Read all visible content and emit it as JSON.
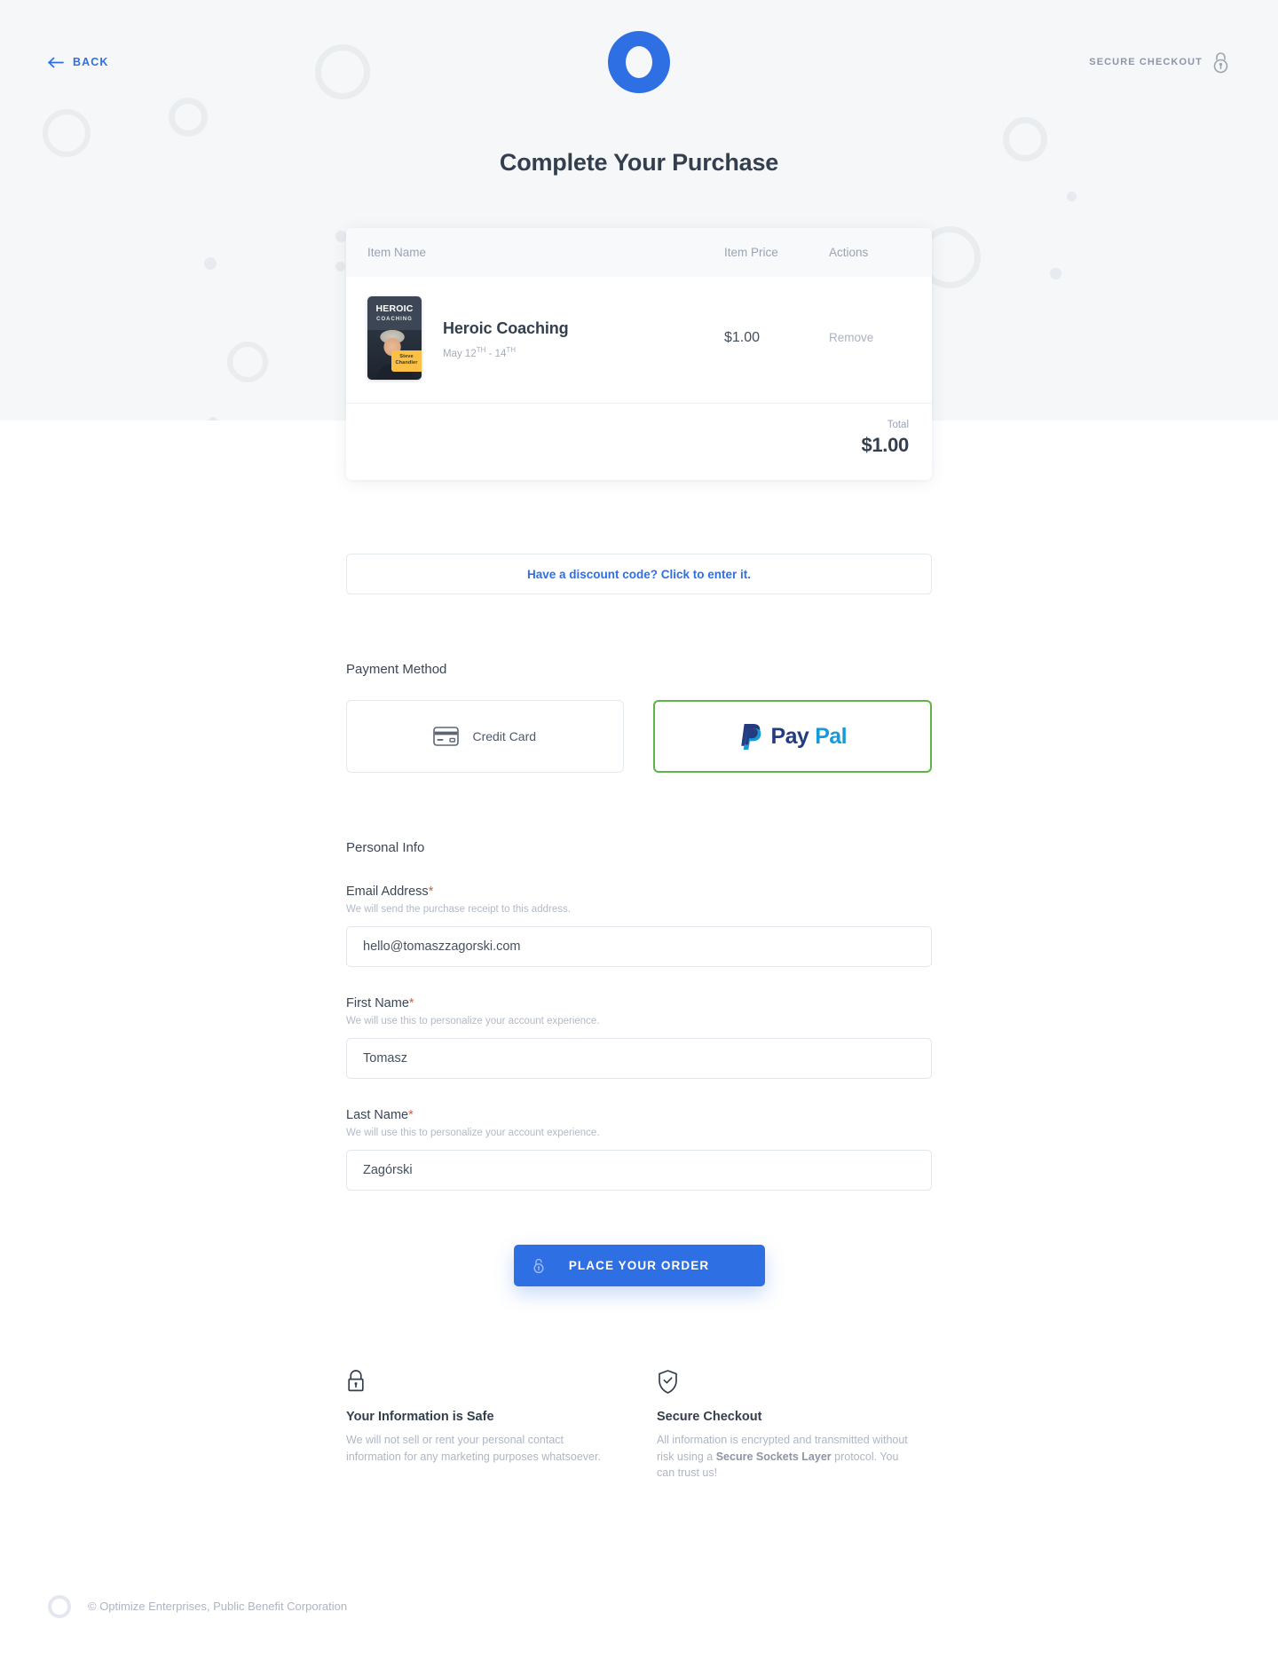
{
  "header": {
    "back_label": "BACK",
    "back_icon": "arrow-left-icon",
    "logo_icon": "optimize-ring-logo",
    "secure_label": "SECURE CHECKOUT",
    "secure_icon": "padlock-round-icon"
  },
  "page_title": "Complete Your Purchase",
  "cart": {
    "columns": {
      "item_name": "Item Name",
      "item_price": "Item Price",
      "actions": "Actions"
    },
    "items": [
      {
        "thumb_title": "HEROIC",
        "thumb_subtitle": "COACHING",
        "thumb_tag_line1": "Steve",
        "thumb_tag_line2": "Chandler",
        "name": "Heroic Coaching",
        "date_prefix": "May 12",
        "date_sup1": "TH",
        "date_middle": " - 14",
        "date_sup2": "TH",
        "price": "$1.00",
        "remove_label": "Remove"
      }
    ],
    "total_label": "Total",
    "total_value": "$1.00"
  },
  "discount": {
    "label": "Have a discount code? Click to enter it."
  },
  "payment": {
    "section_title": "Payment Method",
    "options": [
      {
        "label": "Credit Card",
        "icon": "credit-card-icon",
        "selected": false
      },
      {
        "label_part1": "Pay",
        "label_part2": "Pal",
        "icon": "paypal-logo-icon",
        "selected": true
      }
    ]
  },
  "personal_info": {
    "section_title": "Personal Info",
    "fields": [
      {
        "label": "Email Address",
        "required_mark": "*",
        "help": "We will send the purchase receipt to this address.",
        "value": "hello@tomaszzagorski.com"
      },
      {
        "label": "First Name",
        "required_mark": "*",
        "help": "We will use this to personalize your account experience.",
        "value": "Tomasz"
      },
      {
        "label": "Last Name",
        "required_mark": "*",
        "help": "We will use this to personalize your account experience.",
        "value": "Zagórski"
      }
    ]
  },
  "order_button": {
    "label": "PLACE YOUR ORDER",
    "icon": "padlock-open-icon"
  },
  "trust": [
    {
      "icon": "padlock-icon",
      "title": "Your Information is Safe",
      "text": "We will not sell or rent your personal contact information for any marketing purposes whatsoever."
    },
    {
      "icon": "shield-check-icon",
      "title": "Secure Checkout",
      "text_part1": "All information is encrypted and transmitted without risk using a ",
      "text_bold": "Secure Sockets Layer",
      "text_part2": " protocol. You can trust us!"
    }
  ],
  "footer": {
    "logo_icon": "optimize-ring-logo-small",
    "copyright": "© Optimize Enterprises, Public Benefit Corporation"
  },
  "colors": {
    "accent_blue": "#2f6fe4",
    "selected_green": "#5cb544",
    "required_red": "#f2562a",
    "hero_bg": "#f5f7f8",
    "heading": "#333f4e"
  }
}
